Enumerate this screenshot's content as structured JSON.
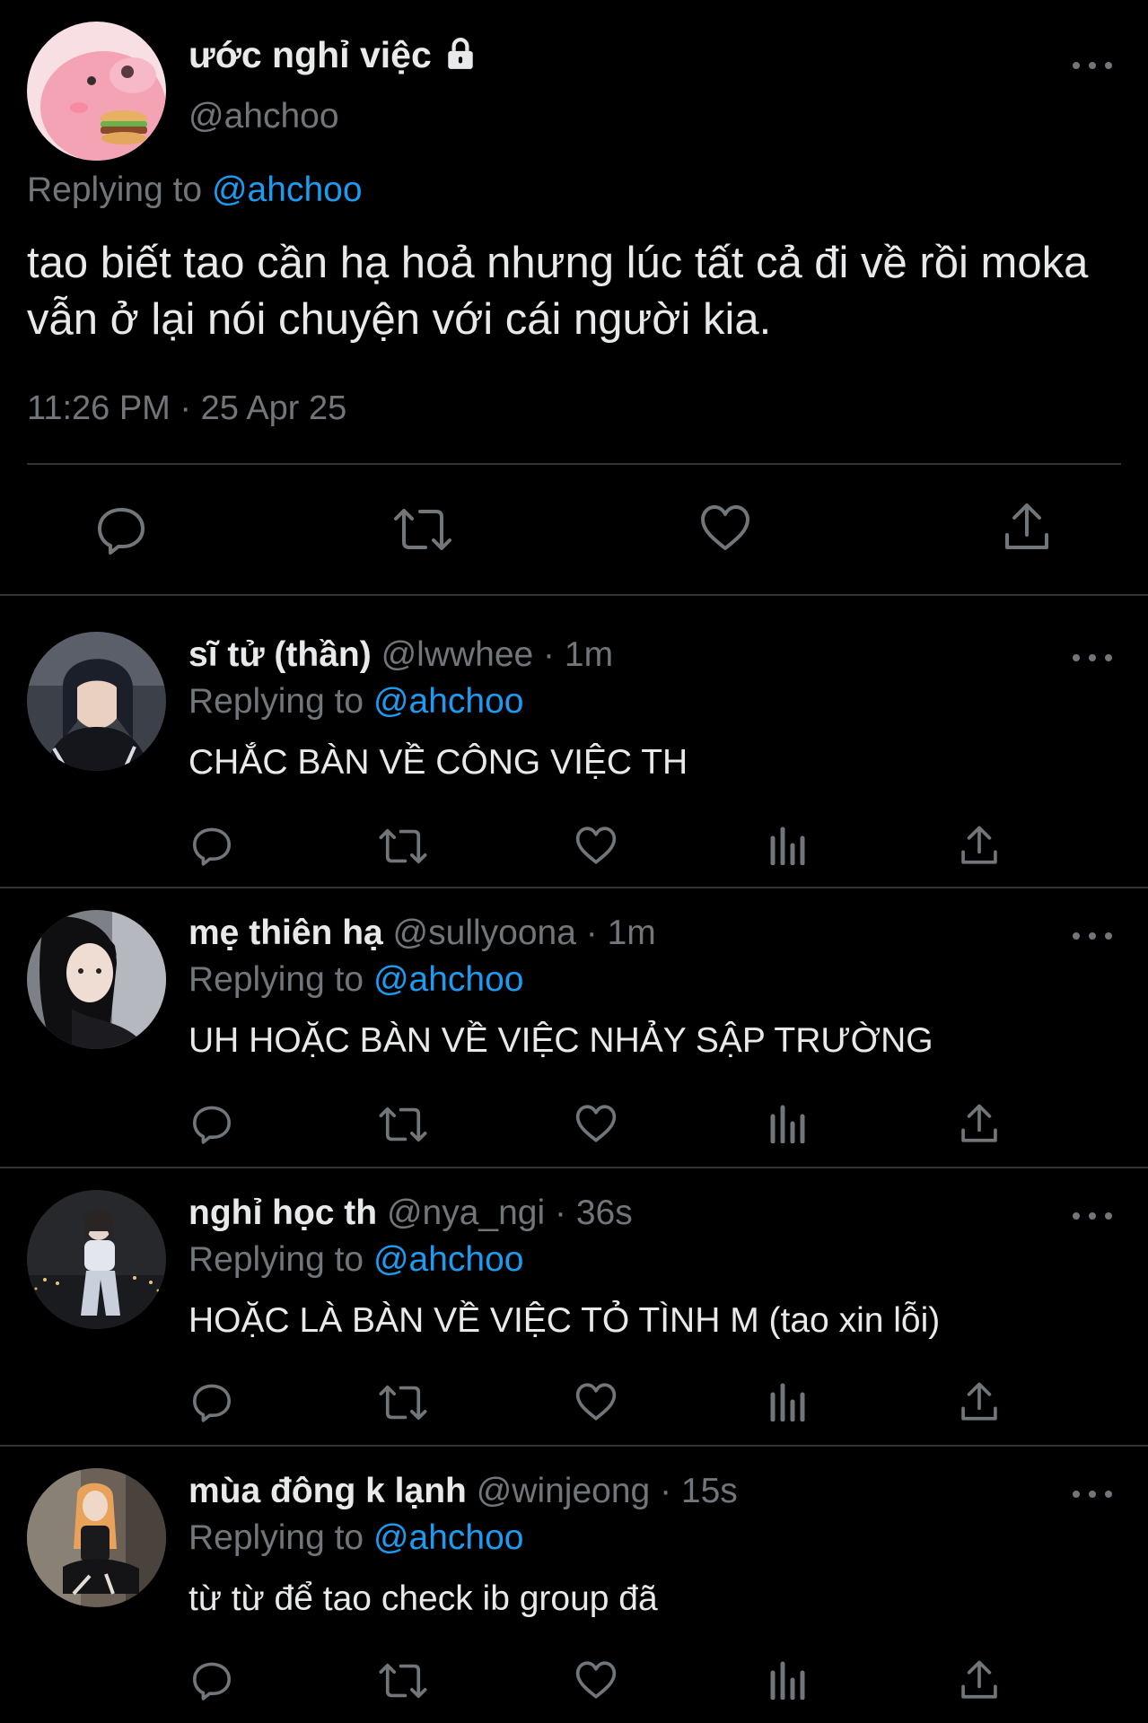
{
  "main_tweet": {
    "display_name": "ước nghỉ việc",
    "handle": "@ahchoo",
    "replying_prefix": "Replying to",
    "replying_mention": "@ahchoo",
    "text": "tao biết tao cần hạ hoả nhưng lúc tất cả đi về rồi moka vẫn ở lại nói chuyện với cái người kia.",
    "timestamp": "11:26 PM · 25 Apr 25",
    "icons": [
      "lock-icon",
      "more-icon",
      "reply-icon",
      "retweet-icon",
      "like-icon",
      "share-icon"
    ]
  },
  "replies": [
    {
      "display_name": "sĩ tử (thần)",
      "meta": " @lwwhee · 1m",
      "replying_prefix": "Replying to ",
      "replying_mention": "@ahchoo",
      "text": "CHẮC BÀN VỀ CÔNG VIỆC TH"
    },
    {
      "display_name": "mẹ thiên hạ",
      "meta": " @sullyoona · 1m",
      "replying_prefix": "Replying to ",
      "replying_mention": "@ahchoo",
      "text": "UH HOẶC BÀN VỀ VIỆC NHẢY SẬP TRƯỜNG"
    },
    {
      "display_name": "nghỉ học th",
      "meta": "  @nya_ngi · 36s",
      "replying_prefix": "Replying to ",
      "replying_mention": "@ahchoo",
      "text": "HOẶC LÀ BÀN VỀ VIỆC TỎ TÌNH M (tao xin lỗi)"
    },
    {
      "display_name": "mùa đông k lạnh",
      "meta": " @winjeong · 15s",
      "replying_prefix": "Replying to ",
      "replying_mention": "@ahchoo",
      "text": "từ từ để tao check ib group đã"
    }
  ],
  "colors": {
    "background": "#000000",
    "text": "#e7e9ea",
    "secondary": "#71767b",
    "link": "#1d9bf0",
    "divider": "#2f3336"
  }
}
